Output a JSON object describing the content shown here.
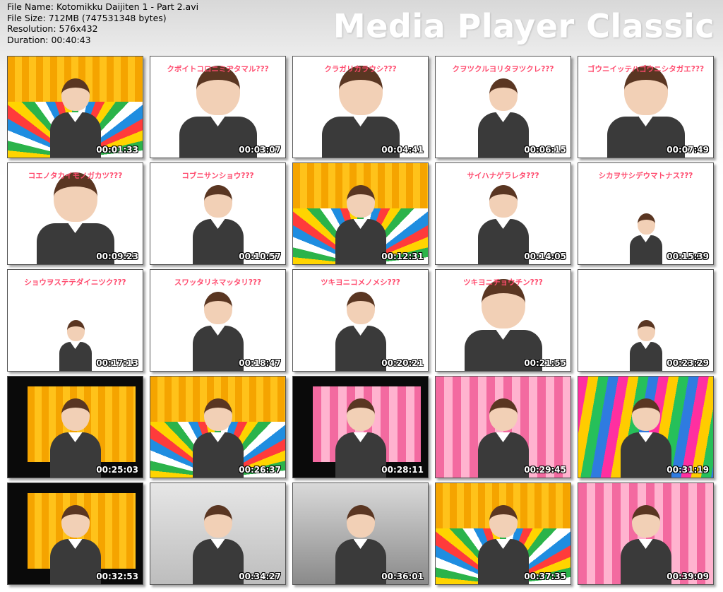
{
  "window": {
    "brand": "Media Player Classic"
  },
  "file_info": {
    "name": "File Name: Kotomikku Daijiten 1 - Part 2.avi",
    "size": "File Size: 712MB (747531348 bytes)",
    "resolution": "Resolution: 576x432",
    "duration": "Duration: 00:40:43"
  },
  "colors": {
    "caption": "#ff4b6e",
    "timestamp": "#ffffff"
  },
  "thumbnails": [
    {
      "time": "00:01:33",
      "caption": "",
      "scene": "yellow-rays"
    },
    {
      "time": "00:03:07",
      "caption": "クボイトコロニミヂタマル???",
      "scene": "white-big"
    },
    {
      "time": "00:04:41",
      "caption": "クラガリカラウシ???",
      "scene": "white-big"
    },
    {
      "time": "00:06:15",
      "caption": "クヲツクルヨリタヲツクレ???",
      "scene": "white-mid"
    },
    {
      "time": "00:07:49",
      "caption": "ゴウニイッテハゴウニシタガエ???",
      "scene": "white-big"
    },
    {
      "time": "00:09:23",
      "caption": "コエノタカイモノガカツ???",
      "scene": "white-big"
    },
    {
      "time": "00:10:57",
      "caption": "コブニサンショウ???",
      "scene": "white-mid"
    },
    {
      "time": "00:12:31",
      "caption": "",
      "scene": "yellow-rays"
    },
    {
      "time": "00:14:05",
      "caption": "サイハナゲラレタ???",
      "scene": "white-mid"
    },
    {
      "time": "00:15:39",
      "caption": "シカヲサシデウマトナス???",
      "scene": "white-small"
    },
    {
      "time": "00:17:13",
      "caption": "ショウヲステテダイニツク???",
      "scene": "white-small"
    },
    {
      "time": "00:18:47",
      "caption": "スワッタリネマッタリ???",
      "scene": "white-mid"
    },
    {
      "time": "00:20:21",
      "caption": "ツキヨニコメノメシ???",
      "scene": "white-mid"
    },
    {
      "time": "00:21:55",
      "caption": "ツキヨニチョウチン???",
      "scene": "white-big"
    },
    {
      "time": "00:23:29",
      "caption": "",
      "scene": "white-small"
    },
    {
      "time": "00:25:03",
      "caption": "",
      "scene": "black-yellow"
    },
    {
      "time": "00:26:37",
      "caption": "",
      "scene": "yellow-rays"
    },
    {
      "time": "00:28:11",
      "caption": "",
      "scene": "black-pink"
    },
    {
      "time": "00:29:45",
      "caption": "",
      "scene": "pink"
    },
    {
      "time": "00:31:19",
      "caption": "",
      "scene": "colorful"
    },
    {
      "time": "00:32:53",
      "caption": "",
      "scene": "black-yellow"
    },
    {
      "time": "00:34:27",
      "caption": "",
      "scene": "grey"
    },
    {
      "time": "00:36:01",
      "caption": "",
      "scene": "grey-dark"
    },
    {
      "time": "00:37:35",
      "caption": "",
      "scene": "yellow-rays"
    },
    {
      "time": "00:39:09",
      "caption": "",
      "scene": "pink"
    }
  ]
}
